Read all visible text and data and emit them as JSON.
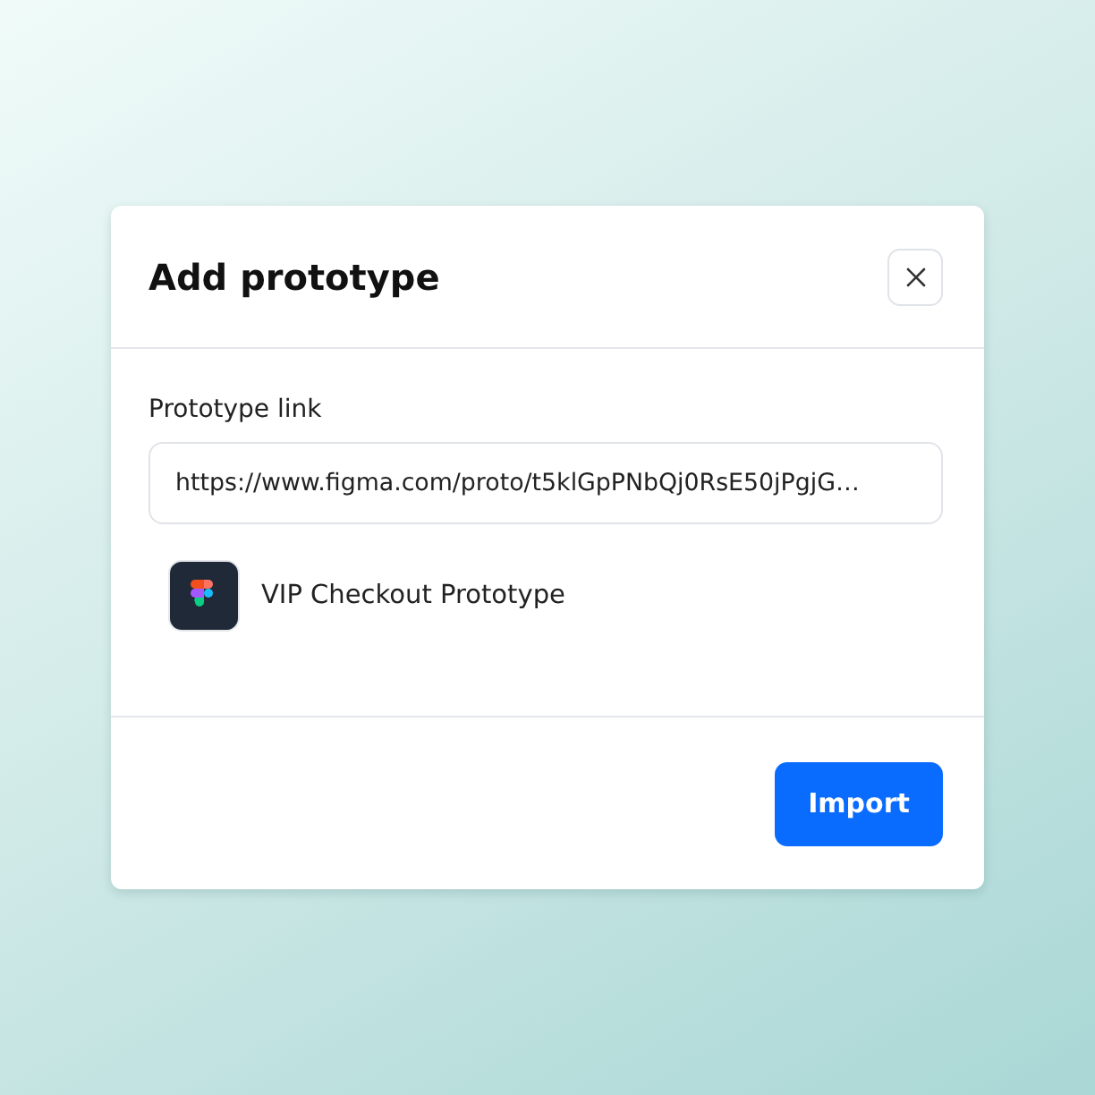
{
  "dialog": {
    "title": "Add prototype",
    "field": {
      "label": "Prototype link",
      "value": "https://www.figma.com/proto/t5klGpPNbQj0RsE50jPgjG…"
    },
    "file": {
      "name": "VIP Checkout Prototype"
    },
    "buttons": [
      "Import"
    ]
  }
}
